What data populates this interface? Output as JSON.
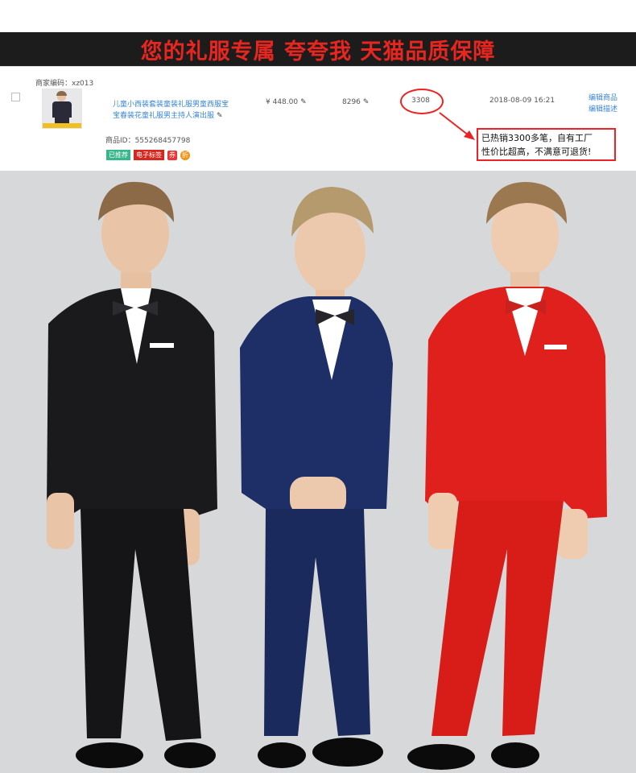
{
  "banner": {
    "text": "您的礼服专属 夸夸我 天猫品质保障"
  },
  "row": {
    "merchant_code": "商家编码：xz013",
    "title_line1": "儿童小西装套装童装礼服男童西服宝",
    "title_line2": "宝春装花童礼服男主持人演出服",
    "price": "¥ 448.00",
    "stock": "8296",
    "sales": "3308",
    "datetime": "2018-08-09 16:21",
    "edit_product": "编辑商品",
    "edit_desc": "编辑描述",
    "product_id": "商品ID：555268457798",
    "tag_recommended": "已推荐",
    "tag_etag": "电子标签",
    "tag_icon_a": "券",
    "tag_icon_b": "折",
    "note_line1": "已热销3300多笔，自有工厂",
    "note_line2": "性价比超高，不满意可退货!"
  },
  "photo": {
    "suits": [
      {
        "color_name": "black",
        "jacket": "#1a1a1c",
        "shadow": "#0b0b0c",
        "tie": "#2c2c30",
        "hair": "#8c6a48"
      },
      {
        "color_name": "navy",
        "jacket": "#1d2f66",
        "shadow": "#121d44",
        "tie": "#25252b",
        "hair": "#b49a6c"
      },
      {
        "color_name": "red",
        "jacket": "#e0201c",
        "shadow": "#b5140f",
        "tie": "#c8211e",
        "hair": "#9c7850"
      }
    ]
  },
  "colors": {
    "banner_bg": "#1c1c1c",
    "banner_text": "#e8261f",
    "link": "#3b86d6",
    "annotation_red": "#ee2222",
    "photo_bg": "#d7d8da"
  }
}
